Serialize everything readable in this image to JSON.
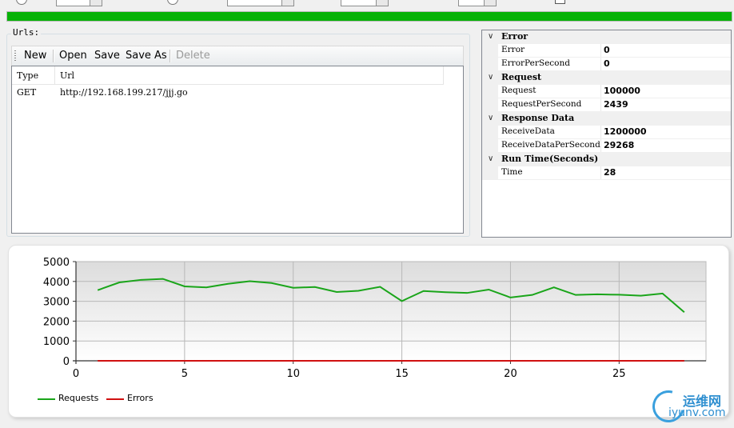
{
  "progress": {
    "value": 100
  },
  "urls": {
    "legend": "Urls:",
    "toolbar": {
      "new": "New",
      "open": "Open",
      "save": "Save",
      "save_as": "Save As",
      "delete": "Delete"
    },
    "columns": [
      "Type",
      "Url"
    ],
    "rows": [
      {
        "type": "GET",
        "url": "http://192.168.199.217/jjj.go"
      }
    ]
  },
  "properties": {
    "categories": [
      {
        "name": "Error",
        "items": [
          {
            "name": "Error",
            "value": "0"
          },
          {
            "name": "ErrorPerSecond",
            "value": "0"
          }
        ]
      },
      {
        "name": "Request",
        "items": [
          {
            "name": "Request",
            "value": "100000"
          },
          {
            "name": "RequestPerSecond",
            "value": "2439"
          }
        ]
      },
      {
        "name": "Response Data",
        "items": [
          {
            "name": "ReceiveData",
            "value": "1200000"
          },
          {
            "name": "ReceiveDataPerSecond",
            "value": "29268"
          }
        ]
      },
      {
        "name": "Run Time(Seconds)",
        "items": [
          {
            "name": "Time",
            "value": "28"
          }
        ]
      }
    ]
  },
  "chart_data": {
    "type": "line",
    "title": "",
    "xlabel": "",
    "ylabel": "",
    "xlim": [
      0,
      29
    ],
    "ylim": [
      0,
      5000
    ],
    "x_ticks": [
      0,
      5,
      10,
      15,
      20,
      25
    ],
    "y_ticks": [
      0,
      1000,
      2000,
      3000,
      4000,
      5000
    ],
    "grid": true,
    "legend_position": "bottom-left",
    "x": [
      1,
      2,
      3,
      4,
      5,
      6,
      7,
      8,
      9,
      10,
      11,
      12,
      13,
      14,
      15,
      16,
      17,
      18,
      19,
      20,
      21,
      22,
      23,
      24,
      25,
      26,
      27,
      28
    ],
    "series": [
      {
        "name": "Requests",
        "color": "#1aa51a",
        "values": [
          3560,
          3950,
          4080,
          4130,
          3750,
          3700,
          3880,
          4010,
          3920,
          3680,
          3720,
          3470,
          3530,
          3730,
          3010,
          3520,
          3460,
          3420,
          3590,
          3190,
          3320,
          3700,
          3320,
          3350,
          3330,
          3280,
          3390,
          2450
        ]
      },
      {
        "name": "Errors",
        "color": "#d01010",
        "values": [
          0,
          0,
          0,
          0,
          0,
          0,
          0,
          0,
          0,
          0,
          0,
          0,
          0,
          0,
          0,
          0,
          0,
          0,
          0,
          0,
          0,
          0,
          0,
          0,
          0,
          0,
          0,
          0
        ]
      }
    ]
  },
  "watermark": {
    "cn": "运维网",
    "en": "iyunv.com"
  }
}
